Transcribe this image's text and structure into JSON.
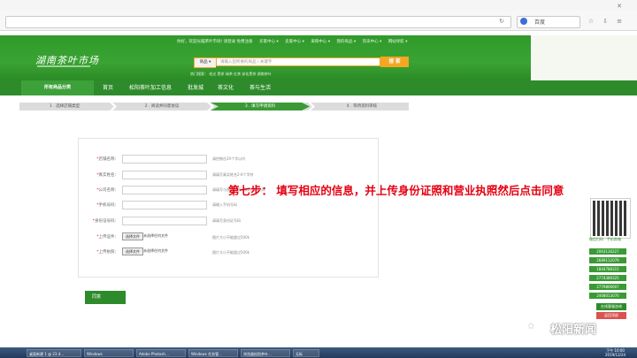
{
  "browser": {
    "search_engine": "百度"
  },
  "header": {
    "logo_text": "湖南茶叶市场",
    "top_links": [
      "你好，欢迎光临茶叶市场! 请登录 免费注册",
      "买家中心 ▾",
      "卖家中心 ▾",
      "采购中心 ▾",
      "我的商品 ▾",
      "资讯中心 ▾",
      "网站导航 ▾"
    ],
    "search_select": "商品 ▾",
    "search_placeholder": "请输入您所要的商品 / 关键字",
    "search_button": "搜 索",
    "hot_text": "热门搜索： 毛尖 黑茶 绿茶 红茶 安化黑茶 湖南茶叶"
  },
  "nav": {
    "category": "所有商品分类",
    "items": [
      "首页",
      "松阳茶叶加工信息",
      "批发城",
      "茶文化",
      "茶与生活"
    ]
  },
  "steps": [
    "1 . 选择店铺类型",
    "2 . 阅读并同意协议",
    "3 . 填写申请资料",
    "4 . 等待资料审核"
  ],
  "form": {
    "fields": [
      {
        "label": "店铺名称：",
        "hint": "请控制在20个字以内"
      },
      {
        "label": "真实姓名：",
        "hint": "请填写真实姓名2-6个字符"
      },
      {
        "label": "公司名称：",
        "hint": "请填写与营业执照一致的公司名称"
      },
      {
        "label": "手机号码：",
        "hint": "请输入手机号码"
      },
      {
        "label": "身份证号码：",
        "hint": "请填写身份证号码"
      }
    ],
    "uploads": [
      {
        "label": "上传证件：",
        "button": "选择文件",
        "file": "未选择任何文件",
        "hint": "图片大小不能超过500k"
      },
      {
        "label": "上传执照：",
        "button": "选择文件",
        "file": "未选择任何文件",
        "hint": "图片大小不能超过500k"
      }
    ],
    "submit": "同意"
  },
  "annotation": "第七步：  填写相应的信息，并上传身份证照和营业执照然后点击同意",
  "side": {
    "qr_label": "微信扫码 · 手机商城",
    "phones": [
      "2063116227",
      "2689112079",
      "1844788315",
      "2774389325",
      "2779806607",
      "2408013070"
    ],
    "buttons": [
      "在线客服咨询",
      "返回顶部"
    ]
  },
  "watermark": "松阳新闻",
  "taskbar": {
    "tasks": [
      "桌面新建 1 @ 23.4...",
      "Windows",
      "Adobe Photosh...",
      "Windows 任务管...",
      "浏览器松阳茶叶...",
      "无标"
    ],
    "time": "下午 10:00",
    "date": "2019/12/24"
  }
}
